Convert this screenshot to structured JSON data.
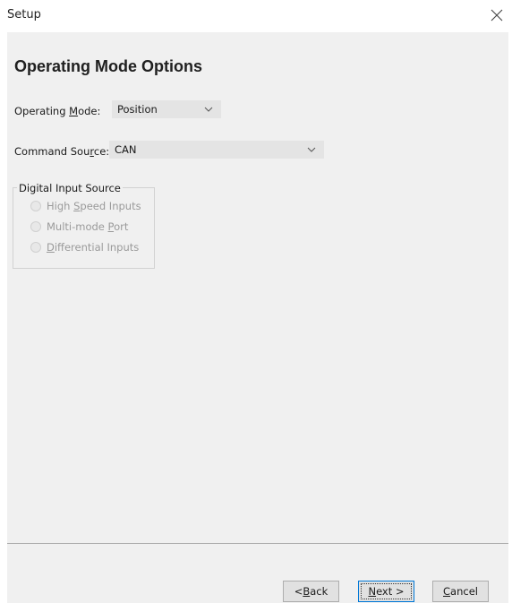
{
  "window": {
    "title": "Setup"
  },
  "page": {
    "heading": "Operating Mode Options"
  },
  "operating_mode": {
    "label_pre": "Operating ",
    "label_mnemonic": "M",
    "label_post": "ode:",
    "selected": "Position"
  },
  "command_source": {
    "label_pre": "Command Sou",
    "label_mnemonic": "r",
    "label_post": "ce:",
    "selected": "CAN"
  },
  "digital_input_source": {
    "legend": "Digital Input Source",
    "options": [
      {
        "pre": "High ",
        "mnemonic": "S",
        "post": "peed Inputs"
      },
      {
        "pre": "Multi-mode ",
        "mnemonic": "P",
        "post": "ort"
      },
      {
        "pre": "",
        "mnemonic": "D",
        "post": "ifferential Inputs"
      }
    ]
  },
  "buttons": {
    "back": {
      "pre": "< ",
      "mnemonic": "B",
      "post": "ack"
    },
    "next": {
      "pre": "",
      "mnemonic": "N",
      "post": "ext >"
    },
    "cancel": {
      "pre": "",
      "mnemonic": "C",
      "post": "ancel"
    }
  },
  "icons": {
    "close": "close-icon",
    "dropdown": "chevron-down-icon",
    "radio": "radio-button-icon"
  },
  "colors": {
    "panel_bg": "#f0f0f0",
    "combo_bg": "#e4e4e4",
    "button_bg": "#e1e1e1",
    "default_button_border": "#0078d7",
    "disabled_text": "#9a9a9a"
  }
}
